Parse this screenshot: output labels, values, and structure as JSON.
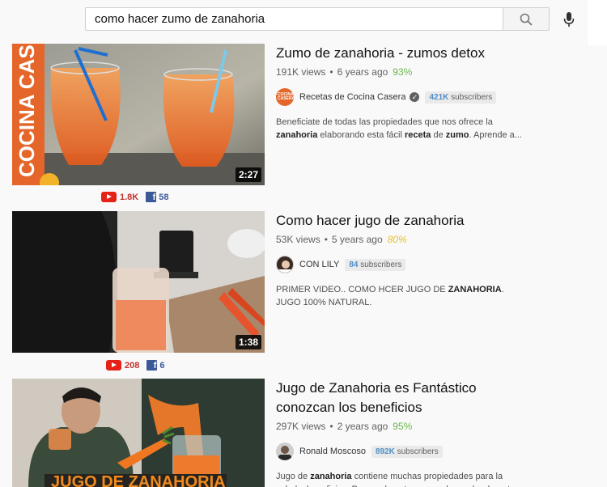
{
  "search": {
    "query": "como hacer zumo de zanahoria"
  },
  "icons": {
    "search": "search-icon",
    "mic": "mic-icon",
    "youtube": "youtube-icon",
    "facebook": "facebook-icon",
    "verified": "verified-icon"
  },
  "colors": {
    "rating_green": "#6bb84a",
    "rating_yellow": "#e8c22a",
    "sub_blue": "#4e8ec9",
    "youtube_red": "#e62117",
    "facebook_blue": "#3b5998"
  },
  "results": [
    {
      "title": "Zumo de zanahoria - zumos detox",
      "views": "191K views",
      "age": "6 years ago",
      "rating": "93%",
      "channel": "Recetas de Cocina Casera",
      "verified": true,
      "subs_count": "421K",
      "subs_label": "subscribers",
      "desc_parts": [
        "Beneficiate de todas las propiedades que nos ofrece la ",
        "zanahoria",
        " elaborando esta fácil ",
        "receta",
        " de ",
        "zumo",
        ". Aprende a..."
      ],
      "duration": "2:27",
      "thumb_text": "COCINA CASERA",
      "avatar_text": "COCINA CASERA",
      "yt_count": "1.8K",
      "fb_count": "58"
    },
    {
      "title": "Como hacer jugo de zanahoria",
      "views": "53K views",
      "age": "5 years ago",
      "rating": "80%",
      "channel": "CON LILY",
      "verified": false,
      "subs_count": "84",
      "subs_label": "subscribers",
      "desc_parts": [
        "PRIMER VIDEO.. COMO HCER JUGO DE ",
        "ZANAHORIA",
        ". JUGO 100% NATURAL."
      ],
      "duration": "1:38",
      "yt_count": "208",
      "fb_count": "6"
    },
    {
      "title": "Jugo de Zanahoria es Fantástico conozcan los beneficios",
      "views": "297K views",
      "age": "2 years ago",
      "rating": "95%",
      "channel": "Ronald Moscoso",
      "verified": false,
      "subs_count": "892K",
      "subs_label": "subscribers",
      "desc_parts": [
        "Jugo de ",
        "zanahoria",
        " contiene muchas propiedades para la salud y beneficios. Personalmente me ayudo mucho durante..."
      ],
      "thumb_text": "JUGO DE ZANAHORIA"
    }
  ]
}
